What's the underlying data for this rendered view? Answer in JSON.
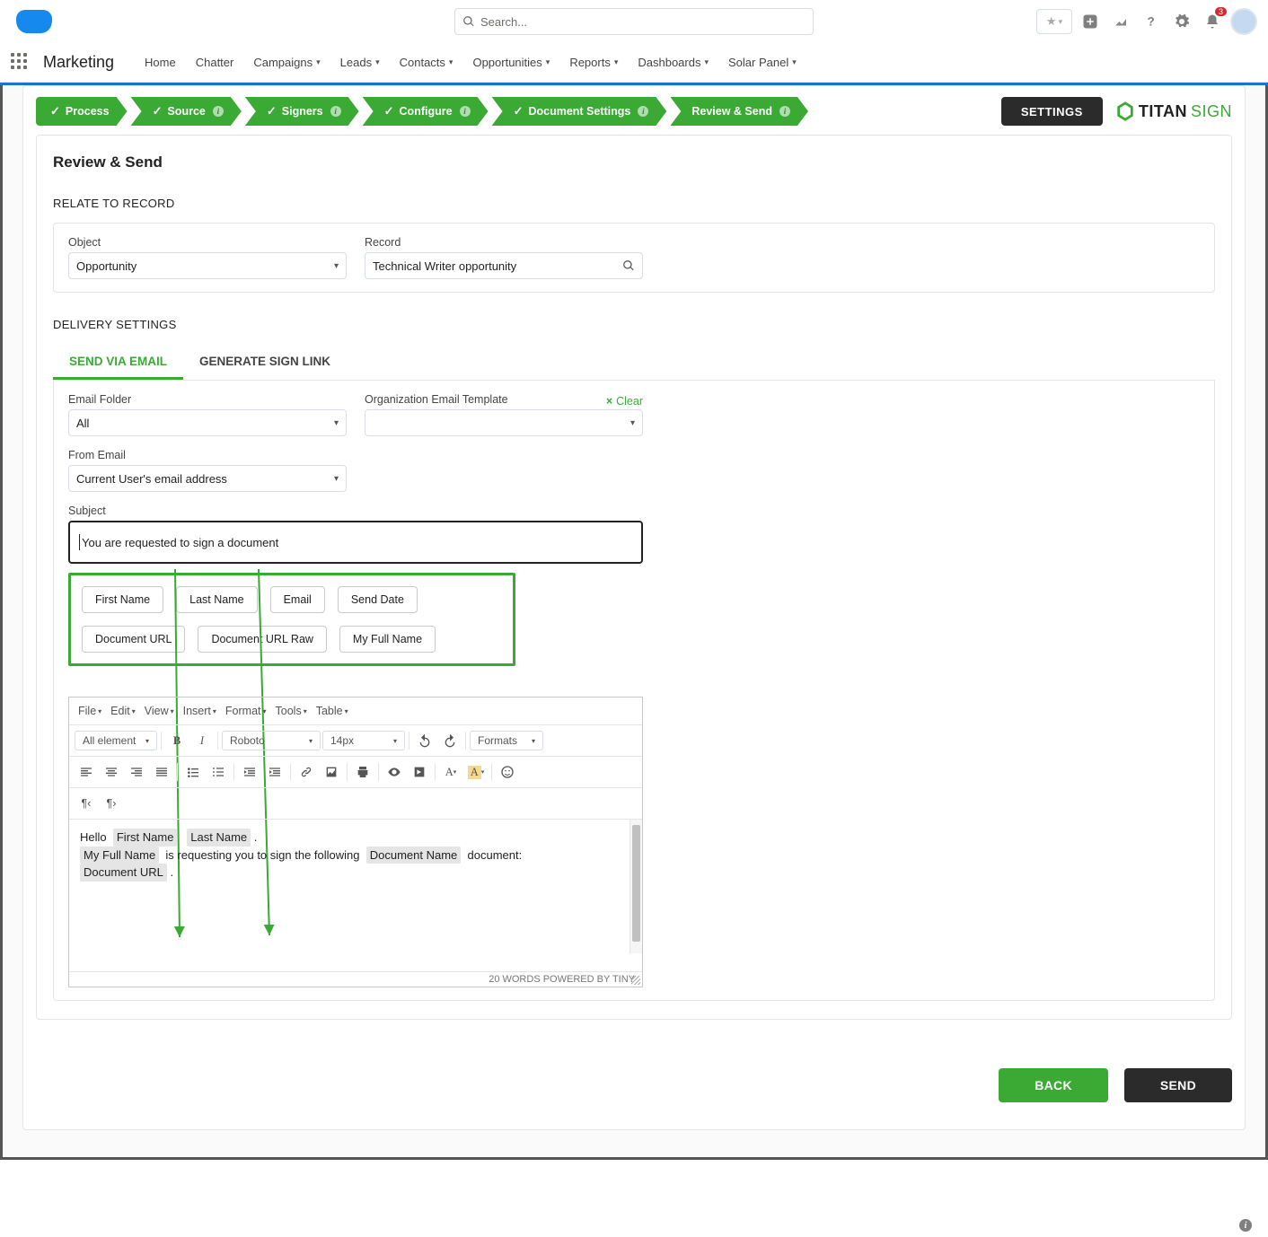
{
  "header": {
    "search_placeholder": "Search...",
    "notification_count": "3"
  },
  "nav": {
    "app_name": "Marketing",
    "items": [
      "Home",
      "Chatter",
      "Campaigns",
      "Leads",
      "Contacts",
      "Opportunities",
      "Reports",
      "Dashboards",
      "Solar Panel"
    ],
    "dropdowns": [
      false,
      false,
      true,
      true,
      true,
      true,
      true,
      true,
      true
    ]
  },
  "stepper": {
    "steps": [
      "Process",
      "Source",
      "Signers",
      "Configure",
      "Document Settings",
      "Review & Send"
    ],
    "settings_label": "SETTINGS",
    "brand_a": "TITAN",
    "brand_b": "SIGN"
  },
  "page": {
    "title": "Review & Send",
    "relate_label": "RELATE TO RECORD",
    "object_label": "Object",
    "object_value": "Opportunity",
    "record_label": "Record",
    "record_value": "Technical Writer opportunity",
    "delivery_label": "DELIVERY SETTINGS",
    "tabs": {
      "email": "SEND VIA EMAIL",
      "link": "GENERATE SIGN LINK"
    },
    "email_folder_label": "Email Folder",
    "email_folder_value": "All",
    "org_tmpl_label": "Organization Email Template",
    "clear_label": "Clear",
    "from_email_label": "From Email",
    "from_email_value": "Current User's email address",
    "subject_label": "Subject",
    "subject_value": "You are requested to sign a document",
    "merge_tags": [
      "First Name",
      "Last Name",
      "Email",
      "Send Date",
      "Document URL",
      "Document URL Raw",
      "My Full Name"
    ],
    "editor_menus": [
      "File",
      "Edit",
      "View",
      "Insert",
      "Format",
      "Tools",
      "Table"
    ],
    "tb_elements": "All element",
    "tb_font": "Roboto",
    "tb_size": "14px",
    "tb_formats": "Formats",
    "body_hello": "Hello",
    "chip_first": "First Name",
    "chip_last": "Last Name",
    "chip_myfull": "My Full Name",
    "body_mid": "is requesting you to sign the following",
    "chip_docname": "Document Name",
    "body_docword": "document:",
    "chip_docurl": "Document URL",
    "footer_text": "20 WORDS POWERED BY TINY",
    "back_label": "BACK",
    "send_label": "SEND"
  }
}
